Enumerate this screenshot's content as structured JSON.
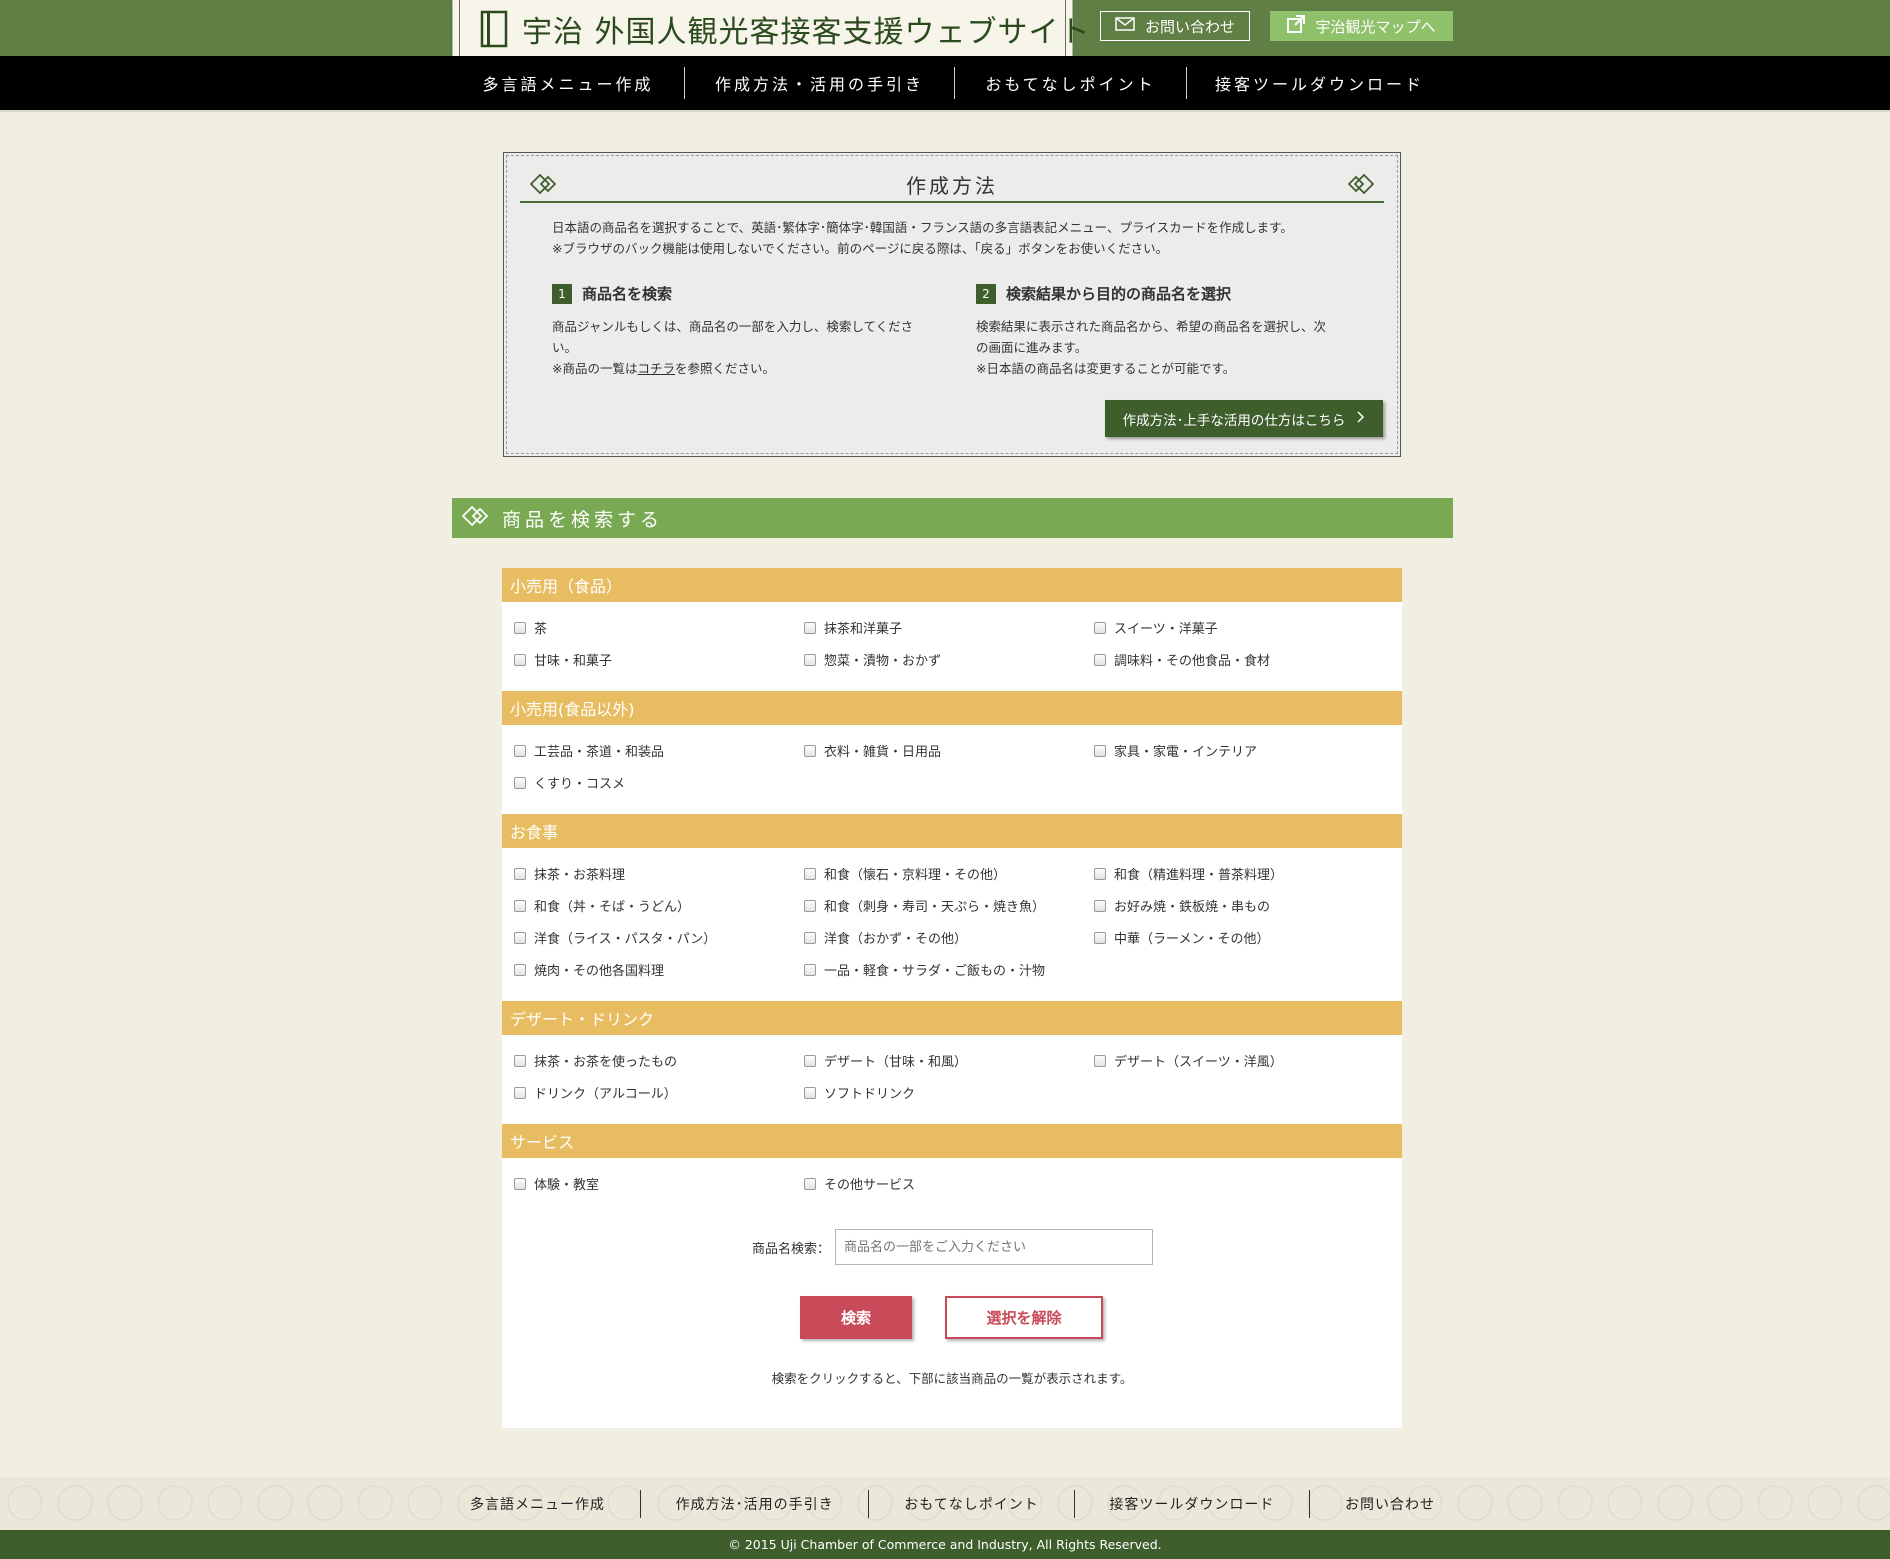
{
  "header": {
    "site_title": "宇治 外国人観光客接客支援ウェブサイト",
    "contact_label": "お問い合わせ",
    "map_label": "宇治観光マップへ"
  },
  "nav": [
    {
      "label": "多言語メニュー作成"
    },
    {
      "label": "作成方法・活用の手引き"
    },
    {
      "label": "おもてなしポイント"
    },
    {
      "label": "接客ツールダウンロード"
    }
  ],
  "howto": {
    "title": "作成方法",
    "intro_line1": "日本語の商品名を選択することで、英語･繁体字･簡体字･韓国語・フランス語の多言語表記メニュー、プライスカードを作成します。",
    "intro_line2": "※ブラウザのバック機能は使用しないでください。前のページに戻る際は、「戻る」ボタンをお使いください。",
    "step1": {
      "num": "1",
      "title": "商品名を検索",
      "line1": "商品ジャンルもしくは、商品名の一部を入力し、検索してくださ",
      "line2": "い。",
      "line3_pre": "※商品の一覧は",
      "line3_link": "コチラ",
      "line3_post": "を参照ください。"
    },
    "step2": {
      "num": "2",
      "title": "検索結果から目的の商品名を選択",
      "line1": "検索結果に表示された商品名から、希望の商品名を選択し、次",
      "line2": "の画面に進みます。",
      "line3": "※日本語の商品名は変更することが可能です。"
    },
    "guide_button": "作成方法･上手な活用の仕方はこちら"
  },
  "search_section": {
    "title": "商品を検索する"
  },
  "categories": [
    {
      "title": "小売用（食品）",
      "options": [
        "茶",
        "抹茶和洋菓子",
        "スイーツ・洋菓子",
        "甘味・和菓子",
        "惣菜・漬物・おかず",
        "調味料・その他食品・食材"
      ]
    },
    {
      "title": "小売用(食品以外)",
      "options": [
        "工芸品・茶道・和装品",
        "衣料・雑貨・日用品",
        "家具・家電・インテリア",
        "くすり・コスメ"
      ]
    },
    {
      "title": "お食事",
      "options": [
        "抹茶・お茶料理",
        "和食（懐石・京料理・その他）",
        "和食（精進料理・普茶料理）",
        "和食（丼・そば・うどん）",
        "和食（刺身・寿司・天ぷら・焼き魚）",
        "お好み焼・鉄板焼・串もの",
        "洋食（ライス・パスタ・パン）",
        "洋食（おかず・その他）",
        "中華（ラーメン・その他）",
        "焼肉・その他各国料理",
        "一品・軽食・サラダ・ご飯もの・汁物"
      ]
    },
    {
      "title": "デザート・ドリンク",
      "options": [
        "抹茶・お茶を使ったもの",
        "デザート（甘味・和風）",
        "デザート（スイーツ・洋風）",
        "ドリンク（アルコール）",
        "ソフトドリンク"
      ]
    },
    {
      "title": "サービス",
      "options": [
        "体験・教室",
        "その他サービス"
      ]
    }
  ],
  "search": {
    "label": "商品名検索：",
    "placeholder": "商品名の一部をご入力ください",
    "search_button": "検索",
    "clear_button": "選択を解除",
    "note": "検索をクリックすると、下部に該当商品の一覧が表示されます。"
  },
  "footer": {
    "nav": [
      "多言語メニュー作成",
      "作成方法･活用の手引き",
      "おもてなしポイント",
      "接客ツールダウンロード",
      "お問い合わせ"
    ],
    "copyright": "© 2015 Uji Chamber of Commerce and Industry, All Rights Reserved."
  },
  "colors": {
    "header_green": "#5f7f45",
    "section_green": "#79a952",
    "dark_green": "#3e5e2c",
    "category_gold": "#e8bd62",
    "button_red": "#c94b59",
    "map_button_green": "#8fc06a"
  }
}
